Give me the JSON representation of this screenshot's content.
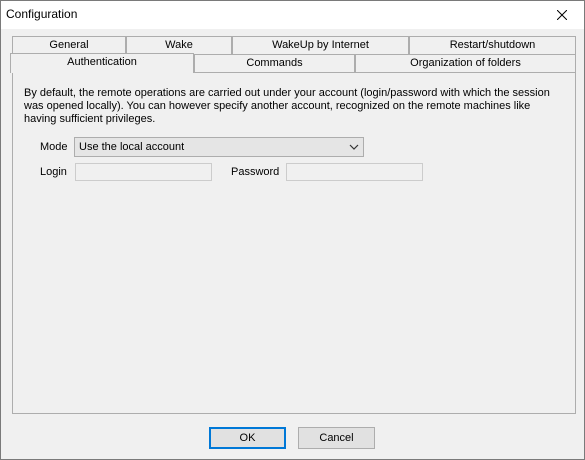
{
  "window": {
    "title": "Configuration",
    "close_glyph": "✕"
  },
  "tabs_row1": [
    {
      "label": "General"
    },
    {
      "label": "Wake"
    },
    {
      "label": "WakeUp by Internet"
    },
    {
      "label": "Restart/shutdown"
    }
  ],
  "tabs_row2": [
    {
      "label": "Authentication",
      "selected": true
    },
    {
      "label": "Commands"
    },
    {
      "label": "Organization of folders"
    }
  ],
  "auth": {
    "description": "By default, the remote operations are carried out under your account (login/password with which the session was opened locally). You can however specify another account, recognized on the remote machines like having sufficient privileges.",
    "mode_label": "Mode",
    "mode_value": "Use the local account",
    "login_label": "Login",
    "login_value": "",
    "password_label": "Password",
    "password_value": ""
  },
  "buttons": {
    "ok": "OK",
    "cancel": "Cancel"
  },
  "icons": {
    "close": "close-icon",
    "dropdown": "chevron-down-icon"
  },
  "colors": {
    "default_button_border": "#0078d7",
    "window_bg": "#f0f0f0",
    "titlebar_bg": "#ffffff"
  }
}
